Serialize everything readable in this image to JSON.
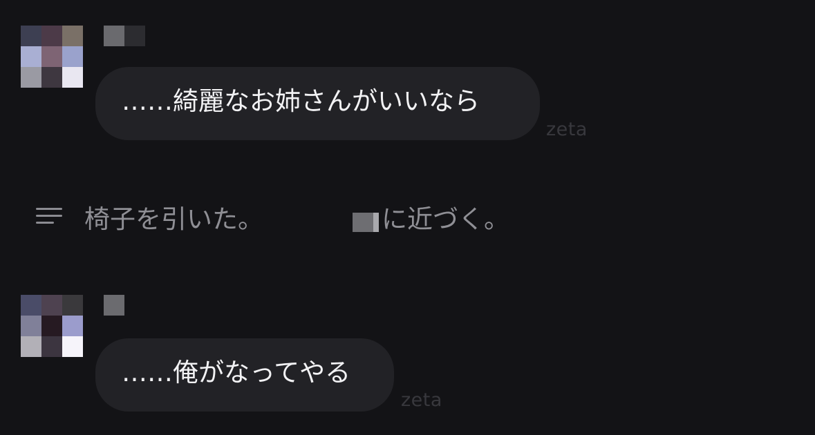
{
  "messages": [
    {
      "avatar_colors": [
        "#3d3f52",
        "#4c3a48",
        "#7a7067",
        "#a9afd3",
        "#7e6474",
        "#9aa2cc",
        "#9a9aa3",
        "#3e3740",
        "#e9e7f1"
      ],
      "name_colors": [
        "#6a6a6e",
        "#2c2c30"
      ],
      "text": "……綺麗なお姉さんがいいなら",
      "brand": "zeta"
    },
    {
      "avatar_colors": [
        "#4a4c68",
        "#4e4250",
        "#3a393c",
        "#808099",
        "#261a22",
        "#9b9ccc",
        "#b2b0b7",
        "#3c3540",
        "#f6f4fa"
      ],
      "name_colors": [
        "#6b6b6f"
      ],
      "text": "……俺がなってやる",
      "brand": "zeta"
    }
  ],
  "narration": {
    "icon": "menu-lines-icon",
    "text_before": "椅子を引いた。",
    "text_after": "に近づく。"
  }
}
